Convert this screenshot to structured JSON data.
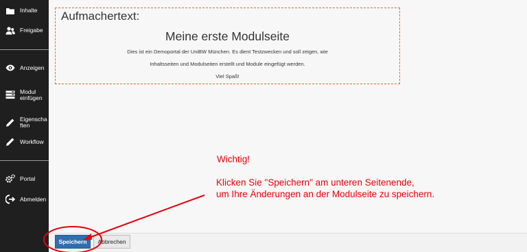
{
  "sidebar": {
    "items": [
      {
        "label": "Inhalte",
        "icon": "folder-icon"
      },
      {
        "label": "Freigabe",
        "icon": "users-icon"
      },
      {
        "label": "Anzeigen",
        "icon": "eye-icon"
      },
      {
        "label": "Modul einfügen",
        "icon": "module-icon"
      },
      {
        "label": "Eigenschaften",
        "icon": "pencil-icon"
      },
      {
        "label": "Workflow",
        "icon": "pencil-icon"
      },
      {
        "label": "Portal",
        "icon": "gears-icon"
      },
      {
        "label": "Abmelden",
        "icon": "logout-icon"
      }
    ]
  },
  "teaser": {
    "label": "Aufmachertext:",
    "title": "Meine erste Modulseite",
    "lines": [
      "Dies ist ein Demoportal der UniBW München. Es dient Testzwecken und soll zeigen, wie",
      "Inhaltsseiten und Modulseiten erstellt und Module eingefügt werden.",
      "Viel Spaß!"
    ]
  },
  "annotation": {
    "heading": "Wichtig!",
    "line1": "Klicken Sie \"Speichern\" am unteren Seitenende,",
    "line2": "um Ihre Änderungen an der Modulseite zu speichern.",
    "color": "#e8000a"
  },
  "footer": {
    "save_label": "Speichern",
    "cancel_label": "Abbrechen"
  },
  "colors": {
    "sidebar_bg": "#1f1f1f",
    "accent_orange": "#e06a24",
    "save_blue": "#2f6fb0"
  }
}
